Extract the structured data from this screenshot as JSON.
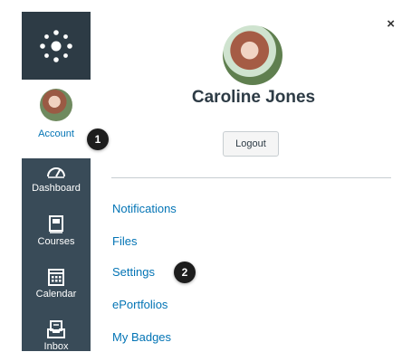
{
  "sidebar": {
    "account_label": "Account",
    "items": [
      {
        "label": "Dashboard",
        "icon": "dashboard-icon"
      },
      {
        "label": "Courses",
        "icon": "courses-icon"
      },
      {
        "label": "Calendar",
        "icon": "calendar-icon"
      },
      {
        "label": "Inbox",
        "icon": "inbox-icon"
      }
    ]
  },
  "callouts": [
    "1",
    "2"
  ],
  "tray": {
    "close_symbol": "×",
    "user_name": "Caroline Jones",
    "logout_label": "Logout",
    "links": [
      "Notifications",
      "Files",
      "Settings",
      "ePortfolios",
      "My Badges"
    ]
  },
  "colors": {
    "sidebar": "#394b58",
    "logo_block": "#2d3b45",
    "link": "#0374b5",
    "badge": "#1d1d1d"
  }
}
